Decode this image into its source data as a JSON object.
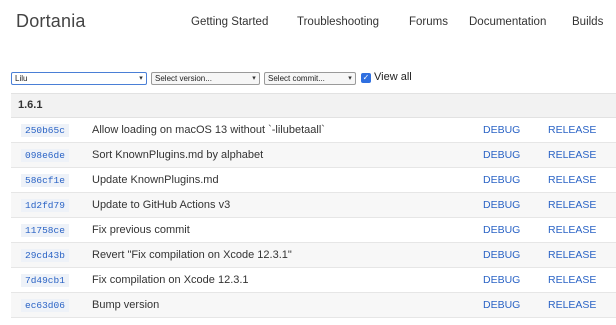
{
  "header": {
    "brand": "Dortania",
    "nav": [
      "Getting Started",
      "Troubleshooting",
      "Forums",
      "Documentation",
      "Builds"
    ]
  },
  "controls": {
    "project_select": "Lilu",
    "version_select": "Select version...",
    "commit_select": "Select commit...",
    "view_all_label": "View all",
    "view_all_checked": true
  },
  "version": "1.6.1",
  "links": {
    "debug": "DEBUG",
    "release": "RELEASE"
  },
  "commits": [
    {
      "hash": "250b65c",
      "message": "Allow loading on macOS 13 without `-lilubetaall`"
    },
    {
      "hash": "098e6de",
      "message": "Sort KnownPlugins.md by alphabet"
    },
    {
      "hash": "586cf1e",
      "message": "Update KnownPlugins.md"
    },
    {
      "hash": "1d2fd79",
      "message": "Update to GitHub Actions v3"
    },
    {
      "hash": "11758ce",
      "message": "Fix previous commit"
    },
    {
      "hash": "29cd43b",
      "message": "Revert \"Fix compilation on Xcode 12.3.1\""
    },
    {
      "hash": "7d49cb1",
      "message": "Fix compilation on Xcode 12.3.1"
    },
    {
      "hash": "ec63d06",
      "message": "Bump version"
    }
  ],
  "colors": {
    "link": "#2a63c5",
    "hash_bg": "#eef2f8",
    "checkbox": "#2f6fe0"
  }
}
